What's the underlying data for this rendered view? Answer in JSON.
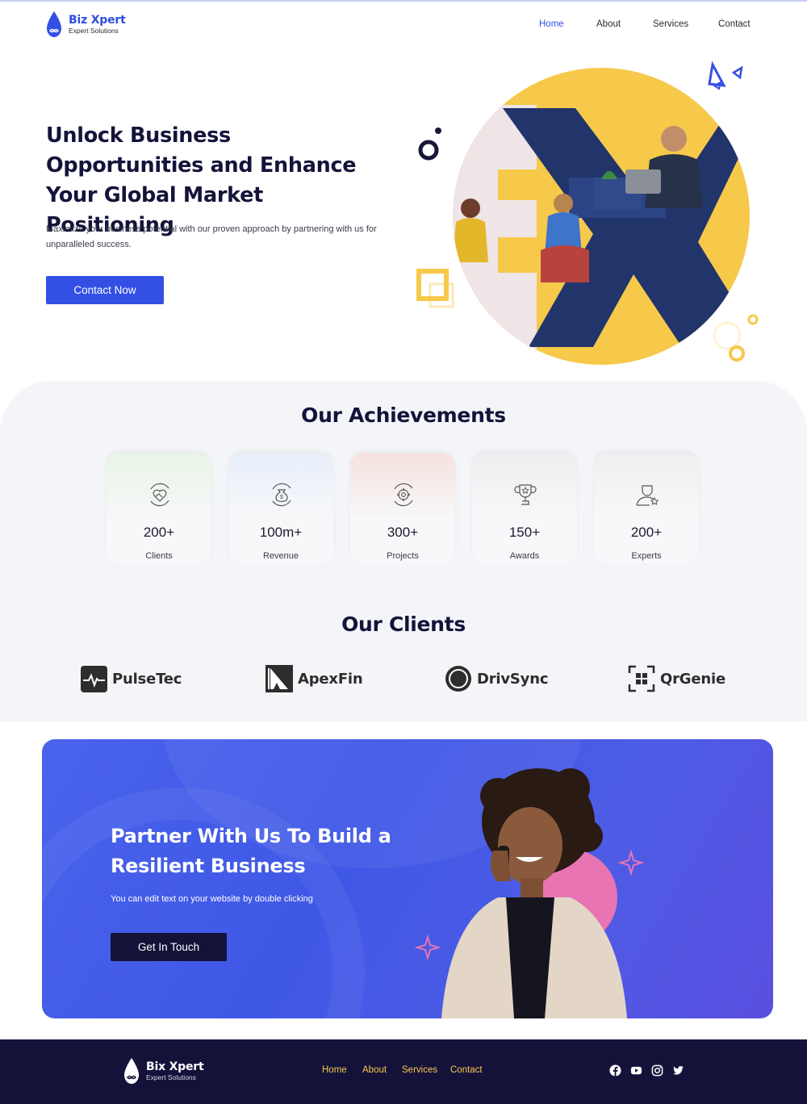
{
  "brand": {
    "name": "Biz Xpert",
    "tagline": "Expert Solutions",
    "accent": "#3450e4",
    "dark": "#15123a",
    "yellow": "#f6c94a"
  },
  "nav": {
    "home": "Home",
    "about": "About",
    "services": "Services",
    "contact": "Contact"
  },
  "hero": {
    "title": "Unlock Business Opportunities and Enhance Your Global Market Positioning",
    "text": "Maximize your business potential with our proven approach by partnering with us for unparalleled success.",
    "cta": "Contact Now"
  },
  "achievements": {
    "title": "Our Achievements",
    "items": [
      {
        "value": "200+",
        "label": "Clients",
        "icon": "handshake-heart-icon"
      },
      {
        "value": "100m+",
        "label": "Revenue",
        "icon": "money-bag-icon"
      },
      {
        "value": "300+",
        "label": "Projects",
        "icon": "gear-cycle-icon"
      },
      {
        "value": "150+",
        "label": "Awards",
        "icon": "trophy-icon"
      },
      {
        "value": "200+",
        "label": "Experts",
        "icon": "expert-star-icon"
      }
    ]
  },
  "clients": {
    "title": "Our Clients",
    "logos": [
      "PulseTec",
      "ApexFin",
      "DrivSync",
      "QrGenie"
    ]
  },
  "cta_banner": {
    "title": "Partner With Us To Build a Resilient Business",
    "text": "You can edit text on your website by double clicking",
    "button": "Get In Touch"
  },
  "footer": {
    "brand": "Bix Xpert",
    "tagline": "Expert Solutions",
    "nav": {
      "home": "Home",
      "about": "About",
      "services": "Services",
      "contact": "Contact"
    },
    "social": [
      "facebook-icon",
      "youtube-icon",
      "instagram-icon",
      "twitter-icon"
    ]
  }
}
